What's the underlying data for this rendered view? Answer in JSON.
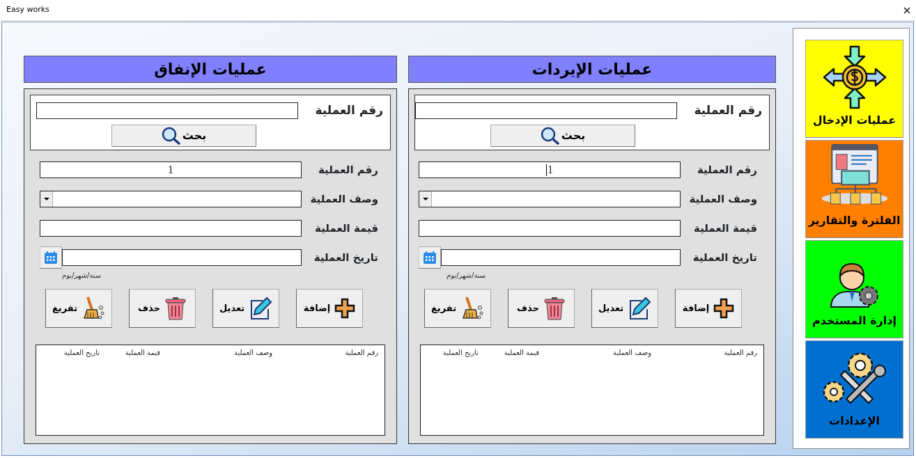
{
  "window": {
    "title": "Easy works"
  },
  "sidebar": {
    "items": [
      {
        "label": "عمليات الإدخال",
        "color": "#ffff00",
        "kind": "entries"
      },
      {
        "label": "الفلترة والتقارير",
        "color": "#ff8000",
        "kind": "reports"
      },
      {
        "label": "إدارة المستخدم",
        "color": "#00ff00",
        "kind": "user"
      },
      {
        "label": "الإعدادات",
        "color": "#0070d0",
        "kind": "settings"
      }
    ]
  },
  "panels": [
    {
      "title": "عمليات الإيردات",
      "search": {
        "label": "رقم العملية",
        "button": "بحث"
      },
      "fields": [
        {
          "label": "رقم العملية",
          "kind": "text",
          "value": "1",
          "focused": true
        },
        {
          "label": "وصف العملية",
          "kind": "combo"
        },
        {
          "label": "قيمة العملية",
          "kind": "text"
        },
        {
          "label": "تاريخ العملية",
          "kind": "date",
          "hint": "سنة/شهر/يوم"
        }
      ],
      "buttons": [
        {
          "label": "إضافة",
          "kind": "add"
        },
        {
          "label": "تعديل",
          "kind": "edit"
        },
        {
          "label": "حذف",
          "kind": "delete"
        },
        {
          "label": "تفريغ",
          "kind": "clear"
        }
      ],
      "list": {
        "columns": [
          "رقم العملية",
          "وصف العملية",
          "قيمة العملية",
          "تاريخ العملية"
        ]
      }
    },
    {
      "title": "عمليات الإنفاق",
      "search": {
        "label": "رقم العملية",
        "button": "بحث"
      },
      "fields": [
        {
          "label": "رقم العملية",
          "kind": "text",
          "value": "1",
          "focused": false
        },
        {
          "label": "وصف العملية",
          "kind": "combo"
        },
        {
          "label": "قيمة العملية",
          "kind": "text"
        },
        {
          "label": "تاريخ العملية",
          "kind": "date",
          "hint": "سنة/شهر/يوم"
        }
      ],
      "buttons": [
        {
          "label": "إضافة",
          "kind": "add"
        },
        {
          "label": "تعديل",
          "kind": "edit"
        },
        {
          "label": "حذف",
          "kind": "delete"
        },
        {
          "label": "تفريغ",
          "kind": "clear"
        }
      ],
      "list": {
        "columns": [
          "رقم العملية",
          "وصف العملية",
          "قيمة العملية",
          "تاريخ العملية"
        ]
      }
    }
  ]
}
